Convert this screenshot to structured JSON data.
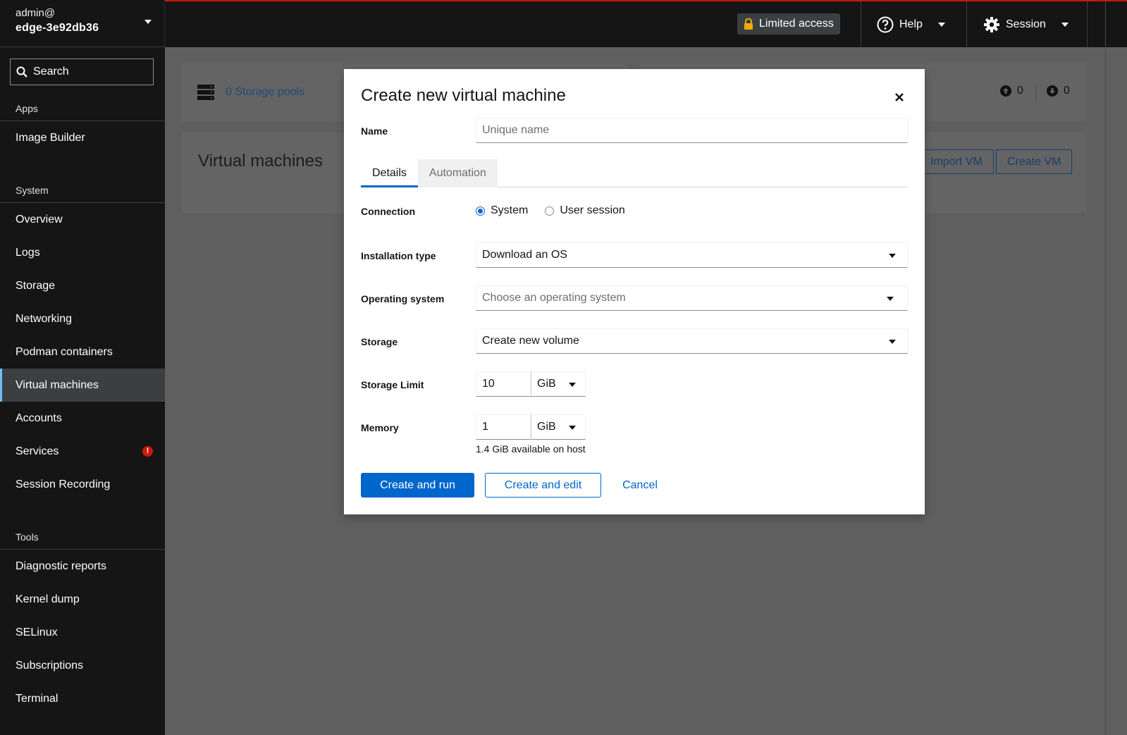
{
  "sidebar": {
    "user": "admin@",
    "host": "edge-3e92db36",
    "search_placeholder": "Search",
    "sections": {
      "apps": "Apps",
      "system": "System",
      "tools": "Tools"
    },
    "apps_items": [
      "Image Builder"
    ],
    "system_items": [
      "Overview",
      "Logs",
      "Storage",
      "Networking",
      "Podman containers",
      "Virtual machines",
      "Accounts",
      "Services",
      "Session Recording"
    ],
    "tools_items": [
      "Diagnostic reports",
      "Kernel dump",
      "SELinux",
      "Subscriptions",
      "Terminal"
    ],
    "active_item": "Virtual machines",
    "services_badge": "!"
  },
  "topbar": {
    "limited_access": "Limited access",
    "help": "Help",
    "session": "Session",
    "accent_color": "#c9190b"
  },
  "background": {
    "storage_pools": "0 Storage pools",
    "networks_up": "0",
    "networks_down": "0",
    "vm_title": "Virtual machines",
    "import_vm": "Import VM",
    "create_vm": "Create VM"
  },
  "modal": {
    "title": "Create new virtual machine",
    "name_label": "Name",
    "name_placeholder": "Unique name",
    "name_value": "",
    "tabs": [
      "Details",
      "Automation"
    ],
    "active_tab": "Details",
    "connection_label": "Connection",
    "connection_options": [
      "System",
      "User session"
    ],
    "connection_selected": "System",
    "installation_type_label": "Installation type",
    "installation_type_value": "Download an OS",
    "operating_system_label": "Operating system",
    "operating_system_placeholder": "Choose an operating system",
    "storage_label": "Storage",
    "storage_value": "Create new volume",
    "storage_limit_label": "Storage Limit",
    "storage_limit_value": "10",
    "storage_limit_unit": "GiB",
    "memory_label": "Memory",
    "memory_value": "1",
    "memory_unit": "GiB",
    "memory_helper": "1.4 GiB available on host",
    "create_and_run": "Create and run",
    "create_and_edit": "Create and edit",
    "cancel": "Cancel",
    "primary_color": "#0066cc"
  }
}
